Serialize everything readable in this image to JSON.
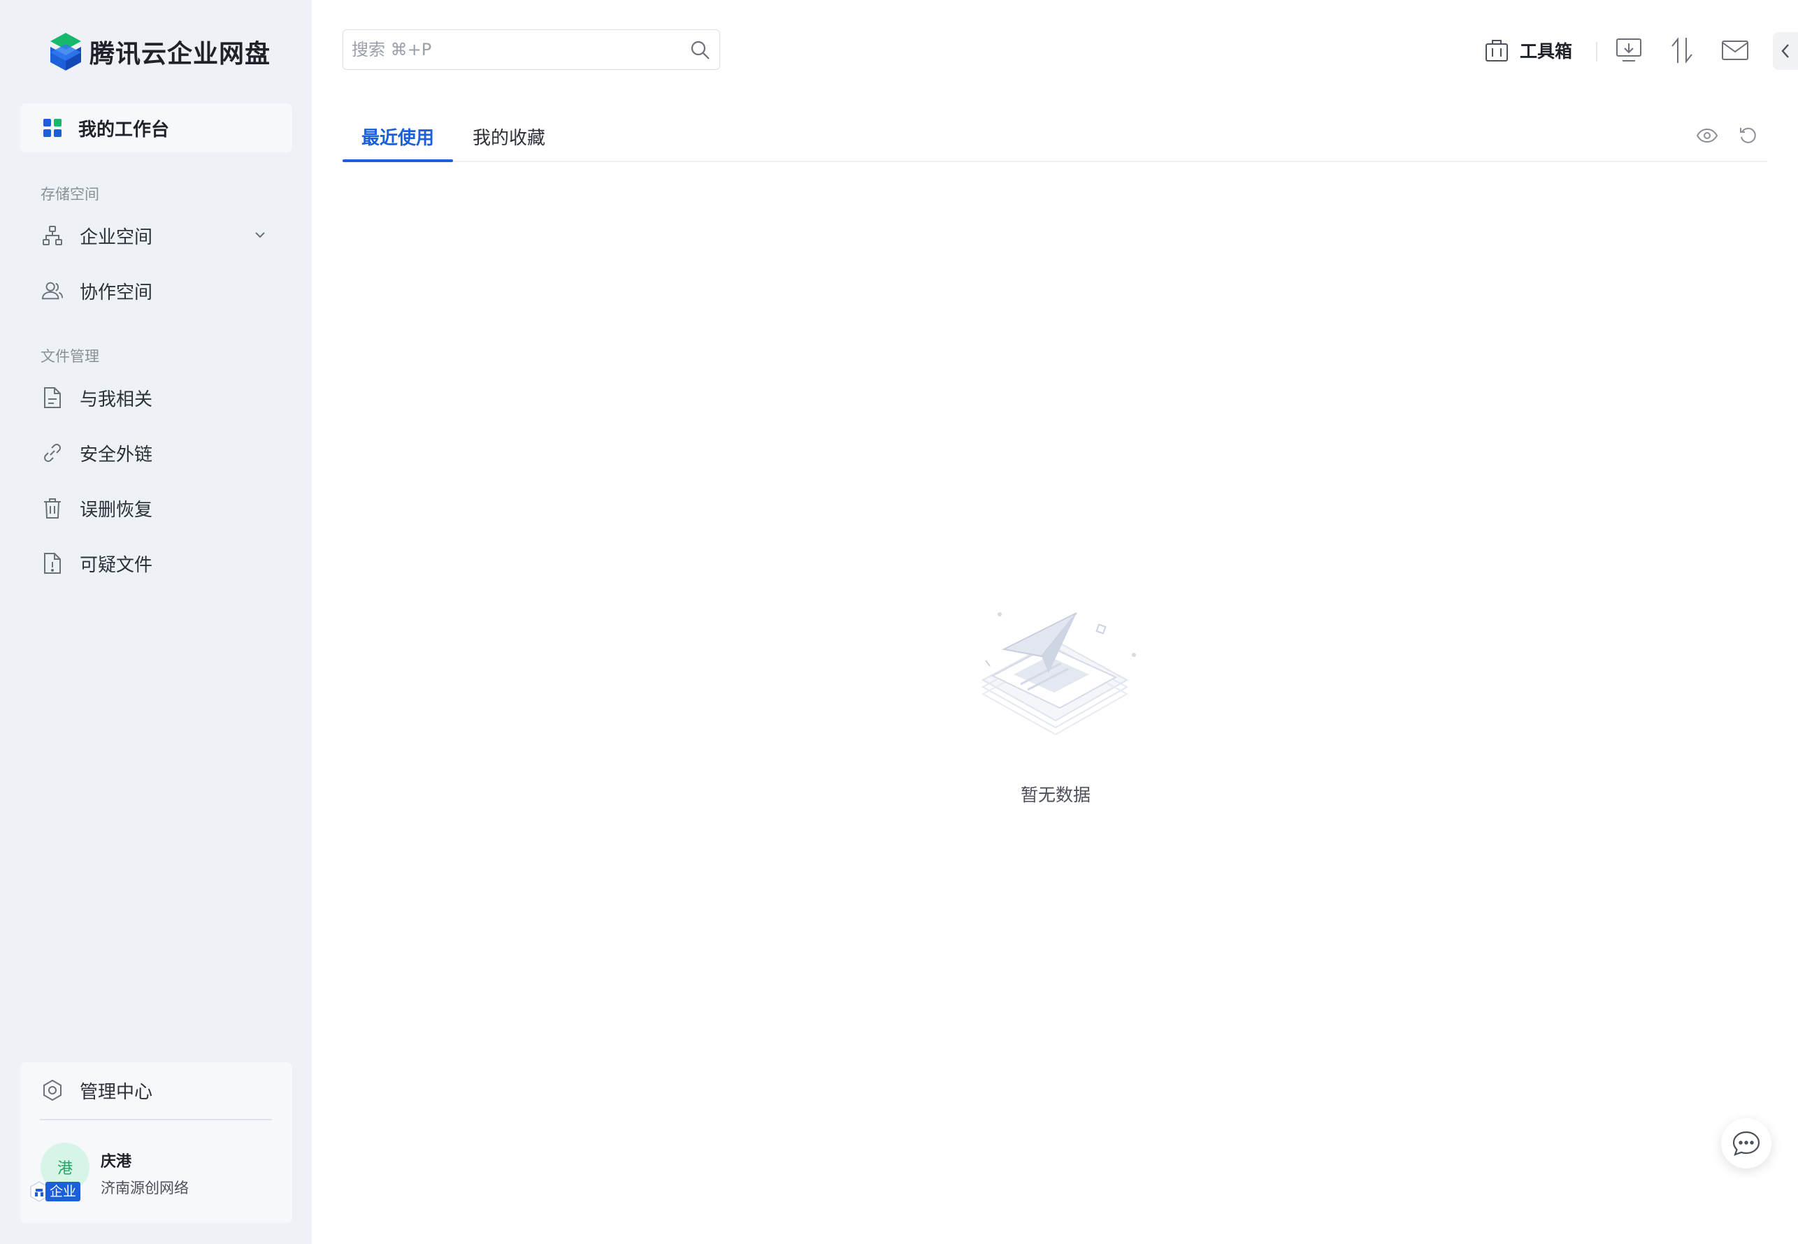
{
  "brand": {
    "name": "腾讯云企业网盘"
  },
  "sidebar": {
    "workbench_label": "我的工作台",
    "storage_title": "存储空间",
    "storage_items": [
      {
        "label": "企业空间",
        "icon": "org-tree-icon",
        "expandable": true
      },
      {
        "label": "协作空间",
        "icon": "users-icon"
      }
    ],
    "files_title": "文件管理",
    "file_items": [
      {
        "label": "与我相关",
        "icon": "file-icon"
      },
      {
        "label": "安全外链",
        "icon": "link-icon"
      },
      {
        "label": "误删恢复",
        "icon": "trash-icon"
      },
      {
        "label": "可疑文件",
        "icon": "warning-file-icon"
      }
    ],
    "admin_label": "管理中心",
    "user": {
      "avatar_text": "港",
      "name": "庆港",
      "org": "济南源创网络",
      "badge": "企业"
    }
  },
  "search": {
    "placeholder": "搜索 ⌘+P",
    "value": ""
  },
  "header": {
    "toolbox_label": "工具箱"
  },
  "tabs": [
    {
      "label": "最近使用",
      "active": true
    },
    {
      "label": "我的收藏",
      "active": false
    }
  ],
  "empty": {
    "text": "暂无数据"
  },
  "colors": {
    "accent": "#1b5fd9",
    "sidebar_bg": "#eef1f6",
    "avatar_bg": "#d7f5e6",
    "avatar_fg": "#1fa866"
  }
}
